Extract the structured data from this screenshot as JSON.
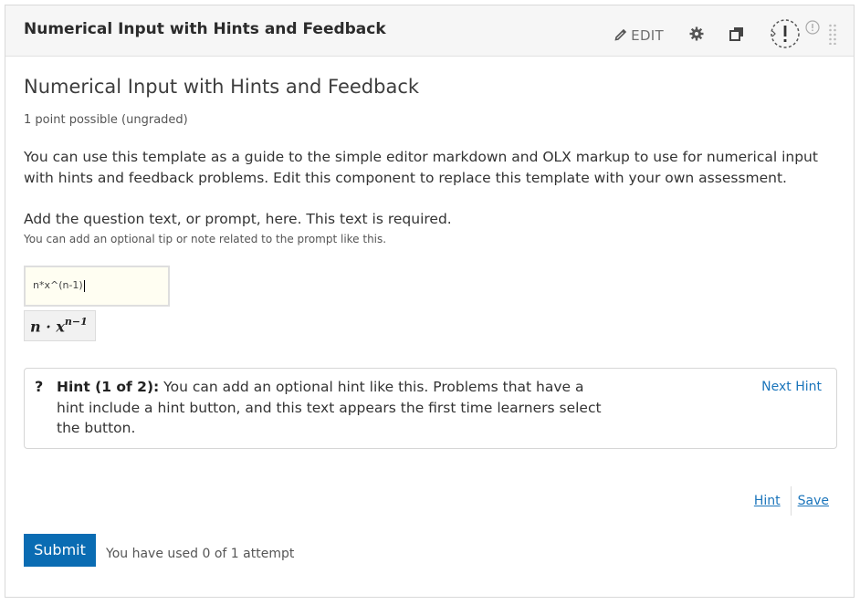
{
  "header": {
    "title": "Numerical Input with Hints and Feedback",
    "edit_label": "EDIT",
    "icons": {
      "edit": "pencil-icon",
      "settings": "gear-icon",
      "duplicate": "copy-icon",
      "visibility": "warning-visibility-icon",
      "info": "info-icon",
      "drag": "drag-handle-icon"
    }
  },
  "problem": {
    "title": "Numerical Input with Hints and Feedback",
    "points": "1 point possible (ungraded)",
    "intro": "You can use this template as a guide to the simple editor markdown and OLX markup to use for numerical input with hints and feedback problems. Edit this component to replace this template with your own assessment.",
    "prompt": "Add the question text, or prompt, here. This text is required.",
    "tip": "You can add an optional tip or note related to the prompt like this.",
    "answer_value": "n*x^(n-1)",
    "preview_base": "n · x",
    "preview_exp": "n−1"
  },
  "hint": {
    "icon": "?",
    "label": "Hint (1 of 2):",
    "text": " You can add an optional hint like this. Problems that have a hint include a hint button, and this text appears the first time learners select the button.",
    "next_label": "Next Hint"
  },
  "actions": {
    "hint_label": "Hint",
    "save_label": "Save",
    "submit_label": "Submit",
    "attempts": "You have used 0 of 1 attempt"
  },
  "colors": {
    "link": "#1b75bb",
    "submit_bg": "#0a6cb3",
    "header_bg": "#f6f6f6",
    "input_bg": "#fffef2"
  }
}
